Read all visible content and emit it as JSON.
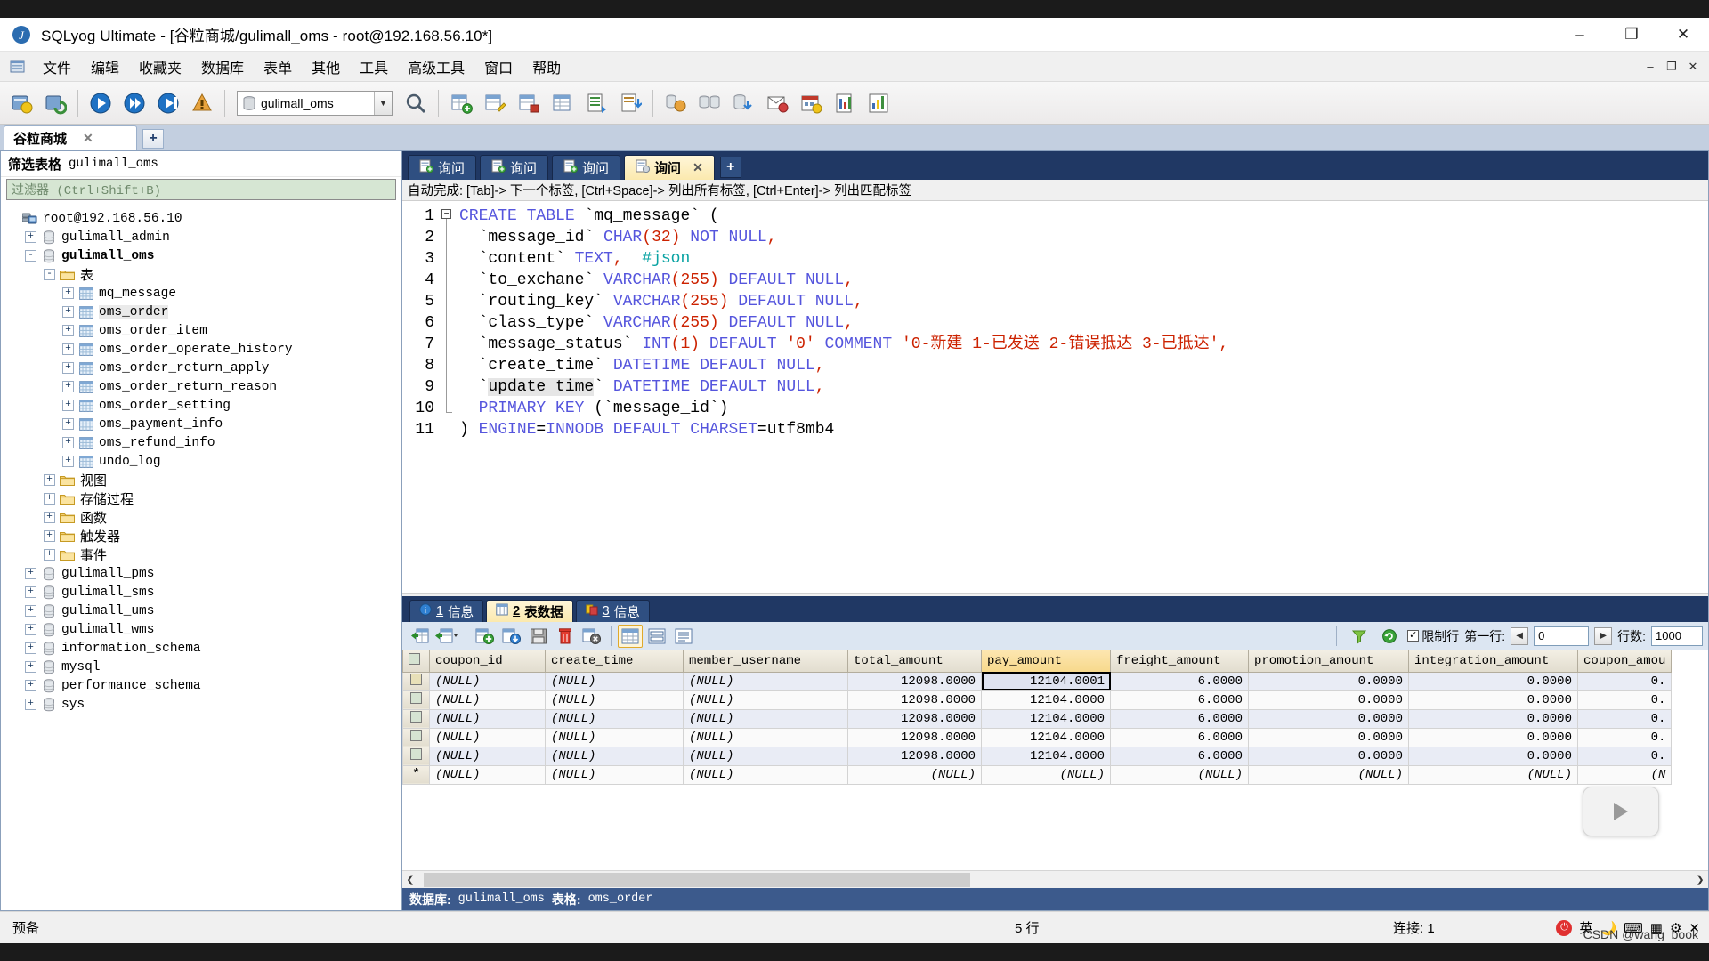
{
  "window": {
    "title": "SQLyog Ultimate - [谷粒商城/gulimall_oms - root@192.168.56.10*]",
    "app_icon": "sqlyog-icon",
    "minimize": "–",
    "maximize": "❐",
    "close": "✕"
  },
  "menubar": {
    "items": [
      "文件",
      "编辑",
      "收藏夹",
      "数据库",
      "表单",
      "其他",
      "工具",
      "高级工具",
      "窗口",
      "帮助"
    ],
    "mdi": {
      "minimize": "–",
      "restore": "❐",
      "close": "✕"
    }
  },
  "toolbar": {
    "db_selector_value": "gulimall_oms",
    "icons": [
      "new-connection-icon",
      "refresh-connection-icon",
      "execute-query-icon",
      "execute-all-icon",
      "execute-current-icon",
      "stop-query-icon"
    ],
    "icons2": [
      "new-table-icon",
      "alter-table-icon",
      "insert-row-icon",
      "table-data-icon",
      "export-csv-icon",
      "import-icon",
      "grid-view-icon",
      "form-view-icon"
    ],
    "icons3": [
      "schema-designer-icon",
      "database-sync-icon",
      "data-sync-icon",
      "notification-icon",
      "backup-icon",
      "scheduler-icon",
      "report-icon",
      "chart-icon"
    ]
  },
  "connection_tabs": {
    "tabs": [
      {
        "label": "谷粒商城",
        "close": "✕"
      }
    ],
    "add_label": "+"
  },
  "sidebar": {
    "filter_title_label": "筛选表格",
    "filter_title_db": "gulimall_oms",
    "filter_placeholder": "过滤器 (Ctrl+Shift+B)",
    "tree": [
      {
        "label": "root@192.168.56.10",
        "icon": "server-icon",
        "indent": 0,
        "toggle": "",
        "bold": false
      },
      {
        "label": "gulimall_admin",
        "icon": "database-icon",
        "indent": 1,
        "toggle": "+",
        "bold": false
      },
      {
        "label": "gulimall_oms",
        "icon": "database-icon",
        "indent": 1,
        "toggle": "-",
        "bold": true
      },
      {
        "label": "表",
        "icon": "folder-icon",
        "indent": 2,
        "toggle": "-",
        "bold": false,
        "cn": true
      },
      {
        "label": "mq_message",
        "icon": "table-icon",
        "indent": 3,
        "toggle": "+",
        "bold": false
      },
      {
        "label": "oms_order",
        "icon": "table-icon",
        "indent": 3,
        "toggle": "+",
        "bold": false,
        "selected": true
      },
      {
        "label": "oms_order_item",
        "icon": "table-icon",
        "indent": 3,
        "toggle": "+",
        "bold": false
      },
      {
        "label": "oms_order_operate_history",
        "icon": "table-icon",
        "indent": 3,
        "toggle": "+",
        "bold": false
      },
      {
        "label": "oms_order_return_apply",
        "icon": "table-icon",
        "indent": 3,
        "toggle": "+",
        "bold": false
      },
      {
        "label": "oms_order_return_reason",
        "icon": "table-icon",
        "indent": 3,
        "toggle": "+",
        "bold": false
      },
      {
        "label": "oms_order_setting",
        "icon": "table-icon",
        "indent": 3,
        "toggle": "+",
        "bold": false
      },
      {
        "label": "oms_payment_info",
        "icon": "table-icon",
        "indent": 3,
        "toggle": "+",
        "bold": false
      },
      {
        "label": "oms_refund_info",
        "icon": "table-icon",
        "indent": 3,
        "toggle": "+",
        "bold": false
      },
      {
        "label": "undo_log",
        "icon": "table-icon",
        "indent": 3,
        "toggle": "+",
        "bold": false
      },
      {
        "label": "视图",
        "icon": "folder-icon",
        "indent": 2,
        "toggle": "+",
        "bold": false,
        "cn": true
      },
      {
        "label": "存储过程",
        "icon": "folder-icon",
        "indent": 2,
        "toggle": "+",
        "bold": false,
        "cn": true
      },
      {
        "label": "函数",
        "icon": "folder-icon",
        "indent": 2,
        "toggle": "+",
        "bold": false,
        "cn": true
      },
      {
        "label": "触发器",
        "icon": "folder-icon",
        "indent": 2,
        "toggle": "+",
        "bold": false,
        "cn": true
      },
      {
        "label": "事件",
        "icon": "folder-icon",
        "indent": 2,
        "toggle": "+",
        "bold": false,
        "cn": true
      },
      {
        "label": "gulimall_pms",
        "icon": "database-icon",
        "indent": 1,
        "toggle": "+",
        "bold": false
      },
      {
        "label": "gulimall_sms",
        "icon": "database-icon",
        "indent": 1,
        "toggle": "+",
        "bold": false
      },
      {
        "label": "gulimall_ums",
        "icon": "database-icon",
        "indent": 1,
        "toggle": "+",
        "bold": false
      },
      {
        "label": "gulimall_wms",
        "icon": "database-icon",
        "indent": 1,
        "toggle": "+",
        "bold": false
      },
      {
        "label": "information_schema",
        "icon": "database-icon",
        "indent": 1,
        "toggle": "+",
        "bold": false
      },
      {
        "label": "mysql",
        "icon": "database-icon",
        "indent": 1,
        "toggle": "+",
        "bold": false
      },
      {
        "label": "performance_schema",
        "icon": "database-icon",
        "indent": 1,
        "toggle": "+",
        "bold": false
      },
      {
        "label": "sys",
        "icon": "database-icon",
        "indent": 1,
        "toggle": "+",
        "bold": false
      }
    ]
  },
  "query_tabs": {
    "tabs": [
      {
        "label": "询问",
        "active": false
      },
      {
        "label": "询问",
        "active": false
      },
      {
        "label": "询问",
        "active": false
      },
      {
        "label": "询问",
        "active": true,
        "close": "✕"
      }
    ],
    "add_label": "+"
  },
  "autocomplete_hint": "自动完成: [Tab]-> 下一个标签, [Ctrl+Space]-> 列出所有标签, [Ctrl+Enter]-> 列出匹配标签",
  "editor": {
    "line_numbers": [
      "1",
      "2",
      "3",
      "4",
      "5",
      "6",
      "7",
      "8",
      "9",
      "10",
      "11"
    ],
    "lines": [
      "CREATE TABLE `mq_message` (",
      "  `message_id` CHAR(32) NOT NULL,",
      "  `content` TEXT,  #json",
      "  `to_exchane` VARCHAR(255) DEFAULT NULL,",
      "  `routing_key` VARCHAR(255) DEFAULT NULL,",
      "  `class_type` VARCHAR(255) DEFAULT NULL,",
      "  `message_status` INT(1) DEFAULT '0' COMMENT '0-新建 1-已发送 2-错误抵达 3-已抵达',",
      "  `create_time` DATETIME DEFAULT NULL,",
      "  `update_time` DATETIME DEFAULT NULL,",
      "  PRIMARY KEY (`message_id`)",
      ") ENGINE=INNODB DEFAULT CHARSET=utf8mb4"
    ],
    "selected_word": "update_time"
  },
  "result_tabs": {
    "tabs": [
      {
        "num": "1",
        "label": "信息",
        "icon": "info-icon",
        "active": false
      },
      {
        "num": "2",
        "label": "表数据",
        "icon": "grid-icon",
        "active": true
      },
      {
        "num": "3",
        "label": "信息",
        "icon": "messages-icon",
        "active": false
      }
    ]
  },
  "result_toolbar": {
    "icons": [
      "refresh-data-icon",
      "refresh-options-icon",
      "insert-row-icon",
      "update-row-icon",
      "save-icon",
      "delete-row-icon",
      "cancel-edit-icon",
      "grid-view-icon",
      "form-view-icon",
      "text-view-icon"
    ],
    "filter_icon": "filter-icon",
    "refresh_icon": "refresh-icon",
    "limit_checkbox_label": "限制行",
    "limit_checked": true,
    "first_row_label": "第一行:",
    "first_row_value": "0",
    "rows_label": "行数:",
    "rows_value": "1000",
    "prev_icon": "◀",
    "next_icon": "▶"
  },
  "grid": {
    "columns": [
      "coupon_id",
      "create_time",
      "member_username",
      "total_amount",
      "pay_amount",
      "freight_amount",
      "promotion_amount",
      "integration_amount",
      "coupon_amou"
    ],
    "highlighted_column": "pay_amount",
    "null_text": "(NULL)",
    "new_row_marker": "*",
    "rows": [
      {
        "coupon_id": "(NULL)",
        "create_time": "(NULL)",
        "member_username": "(NULL)",
        "total_amount": "12098.0000",
        "pay_amount": "12104.0001",
        "freight_amount": "6.0000",
        "promotion_amount": "0.0000",
        "integration_amount": "0.0000",
        "coupon_amou": "0."
      },
      {
        "coupon_id": "(NULL)",
        "create_time": "(NULL)",
        "member_username": "(NULL)",
        "total_amount": "12098.0000",
        "pay_amount": "12104.0000",
        "freight_amount": "6.0000",
        "promotion_amount": "0.0000",
        "integration_amount": "0.0000",
        "coupon_amou": "0."
      },
      {
        "coupon_id": "(NULL)",
        "create_time": "(NULL)",
        "member_username": "(NULL)",
        "total_amount": "12098.0000",
        "pay_amount": "12104.0000",
        "freight_amount": "6.0000",
        "promotion_amount": "0.0000",
        "integration_amount": "0.0000",
        "coupon_amou": "0."
      },
      {
        "coupon_id": "(NULL)",
        "create_time": "(NULL)",
        "member_username": "(NULL)",
        "total_amount": "12098.0000",
        "pay_amount": "12104.0000",
        "freight_amount": "6.0000",
        "promotion_amount": "0.0000",
        "integration_amount": "0.0000",
        "coupon_amou": "0."
      },
      {
        "coupon_id": "(NULL)",
        "create_time": "(NULL)",
        "member_username": "(NULL)",
        "total_amount": "12098.0000",
        "pay_amount": "12104.0000",
        "freight_amount": "6.0000",
        "promotion_amount": "0.0000",
        "integration_amount": "0.0000",
        "coupon_amou": "0."
      },
      {
        "coupon_id": "(NULL)",
        "create_time": "(NULL)",
        "member_username": "(NULL)",
        "total_amount": "(NULL)",
        "pay_amount": "(NULL)",
        "freight_amount": "(NULL)",
        "promotion_amount": "(NULL)",
        "integration_amount": "(NULL)",
        "coupon_amou": "(N",
        "is_new": true
      }
    ],
    "selected_cell": {
      "row": 0,
      "column": "pay_amount"
    }
  },
  "db_status": {
    "db_label": "数据库:",
    "db_value": "gulimall_oms",
    "table_label": "表格:",
    "table_value": "oms_order"
  },
  "statusbar": {
    "left_text": "预备",
    "rows_text": "5 行",
    "connection_label": "连接:",
    "connection_value": "1",
    "tray_ime": "英",
    "watermark": "CSDN @wang_book"
  },
  "colors": {
    "accent_navy": "#203864",
    "tab_active": "#fbe9ae",
    "status_bar": "#3c5a8c",
    "keyword": "#5555dd",
    "number": "#cc2200",
    "comment": "#0aa3a3"
  }
}
